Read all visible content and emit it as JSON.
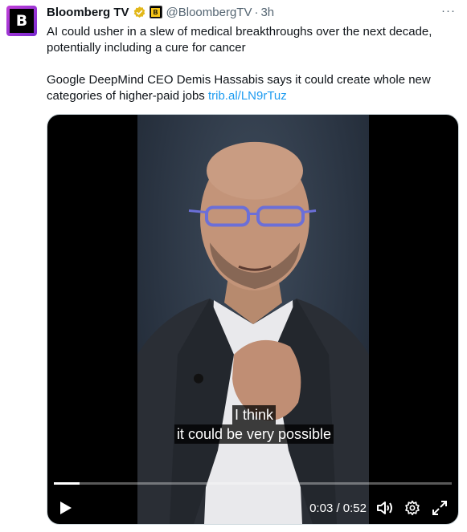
{
  "post": {
    "author_name": "Bloomberg TV",
    "avatar_letter": "B",
    "affiliate_letter": "B",
    "handle": "@BloombergTV",
    "separator": "·",
    "time": "3h",
    "more": "···",
    "text_line1": "AI could usher in a slew of medical breakthroughs over the next decade,",
    "text_line2": "potentially including a cure for cancer",
    "text_line3": "Google DeepMind CEO Demis Hassabis says it could create whole new",
    "text_line4_prefix": "categories of higher-paid jobs ",
    "link": "trib.al/LN9rTuz"
  },
  "video": {
    "subtitle_line1": "I think",
    "subtitle_line2": "it could be very possible",
    "timecode": "0:03 / 0:52",
    "progress_fraction": 0.065
  },
  "colors": {
    "verified": "#e2b719",
    "link": "#1d9bf0",
    "muted": "#536471"
  }
}
